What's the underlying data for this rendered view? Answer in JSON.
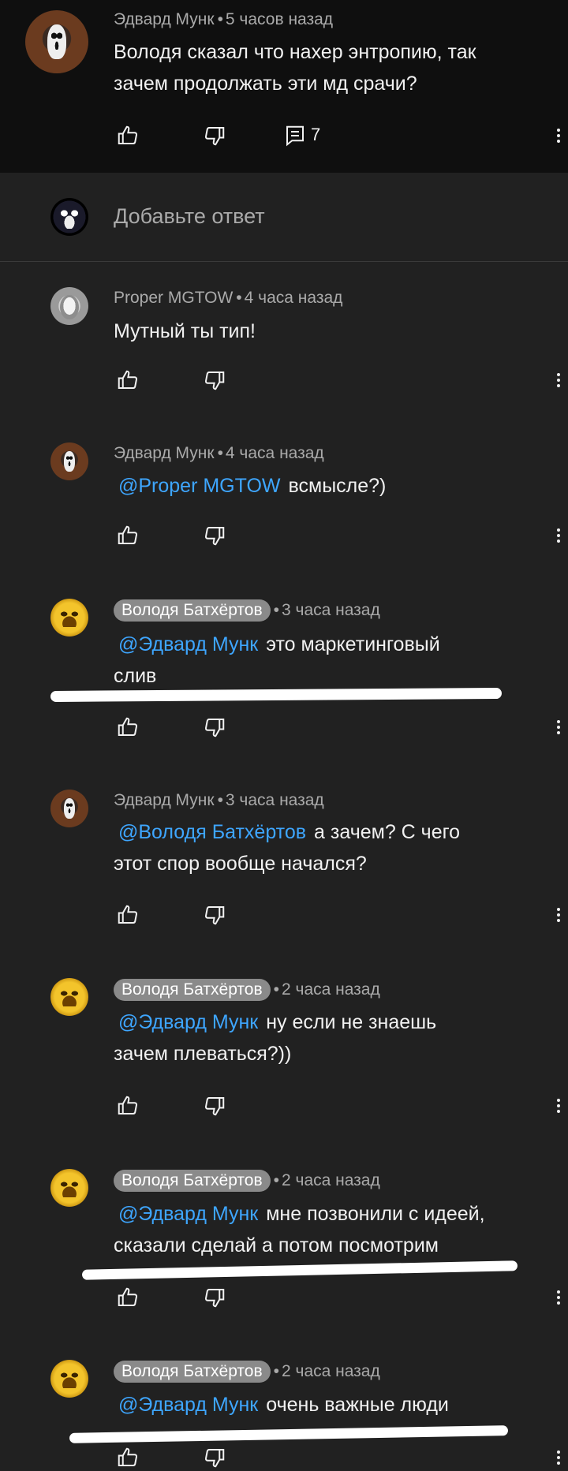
{
  "top_comment": {
    "author": "Эдвард Мунк",
    "time": "5 часов назад",
    "lines": [
      "Володя сказал что нахер энтропию, так",
      "зачем продолжать эти мд срачи?"
    ],
    "reply_count": "7"
  },
  "add_reply": {
    "placeholder": "Добавьте ответ"
  },
  "separator": "•",
  "replies": [
    {
      "author": "Proper MGTOW",
      "time": "4 часа назад",
      "mention": "",
      "lines": [
        "Мутный ты тип!"
      ]
    },
    {
      "author": "Эдвард Мунк",
      "time": "4 часа назад",
      "mention": "@Proper MGTOW",
      "lines": [
        "всмысле?)"
      ]
    },
    {
      "author": "Володя Батхёртов",
      "time": "3 часа назад",
      "mention": "@Эдвард Мунк",
      "lines": [
        "это маркетинговый",
        "слив"
      ]
    },
    {
      "author": "Эдвард Мунк",
      "time": "3 часа назад",
      "mention": "@Володя Батхёртов",
      "lines": [
        "а зачем? С чего",
        "этот спор вообще начался?"
      ]
    },
    {
      "author": "Володя Батхёртов",
      "time": "2 часа назад",
      "mention": "@Эдвард Мунк",
      "lines": [
        "ну если не знаешь",
        "зачем плеваться?))"
      ]
    },
    {
      "author": "Володя Батхёртов",
      "time": "2 часа назад",
      "mention": "@Эдвард Мунк",
      "lines": [
        "мне позвонили с идеей,",
        "сказали сделай а потом посмотрим"
      ]
    },
    {
      "author": "Володя Батхёртов",
      "time": "2 часа назад",
      "mention": "@Эдвард Мунк",
      "lines": [
        "очень важные люди"
      ]
    }
  ],
  "icons": {
    "like": "thumbs-up-icon",
    "dislike": "thumbs-down-icon",
    "replies": "comment-icon",
    "more": "more-vert-icon"
  },
  "colors": {
    "background": "#212121",
    "top_background": "#0f0f0f",
    "mention": "#3ea6ff",
    "meta": "#aaaaaa",
    "chip": "#8a8a8a"
  }
}
